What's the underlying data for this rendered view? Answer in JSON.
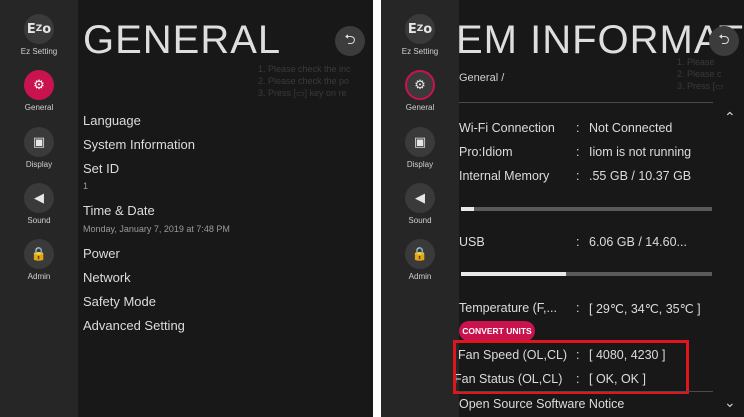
{
  "sidebar": {
    "items": [
      {
        "icon": "Ez",
        "label": "Ez Setting"
      },
      {
        "icon": "gear",
        "label": "General"
      },
      {
        "icon": "monitor",
        "label": "Display"
      },
      {
        "icon": "speaker",
        "label": "Sound"
      },
      {
        "icon": "lock",
        "label": "Admin"
      }
    ],
    "active": "General"
  },
  "left": {
    "title": "GENERAL",
    "ghost_lines": [
      "1. Please check the inc",
      "2. Please check the po",
      "3. Press [",
      "] key on re"
    ],
    "menu": [
      {
        "label": "Language"
      },
      {
        "label": "System Information"
      },
      {
        "label": "Set ID",
        "sub": "1"
      },
      {
        "label": "Time & Date",
        "sub": "Monday, January 7, 2019 at 7:48 PM"
      },
      {
        "label": "Power"
      },
      {
        "label": "Network"
      },
      {
        "label": "Safety Mode"
      },
      {
        "label": "Advanced Setting"
      }
    ]
  },
  "right": {
    "title": "EM INFORMATIC",
    "breadcrumb": "General /",
    "ghost_lines": [
      "1. Please",
      "2. Please c",
      "3. Press ["
    ],
    "rows": [
      {
        "label": "Wi-Fi Connection",
        "value": "Not Connected"
      },
      {
        "label": "Pro:Idiom",
        "value": "Iiom is not running"
      },
      {
        "label": "Internal Memory",
        "value": ".55 GB  /  10.37 GB"
      },
      {
        "label": "USB",
        "value": "6.06 GB  /  14.60..."
      },
      {
        "label": "Temperature (F,...",
        "value": "[ 29℃, 34℃, 35℃ ]"
      },
      {
        "label": "Fan Speed (OL,CL)",
        "value": "[ 4080, 4230 ]"
      },
      {
        "label": "Fan Status (OL,CL)",
        "value": "[ OK, OK ]"
      }
    ],
    "separator": ":",
    "internal_memory_fill": 0.05,
    "usb_fill": 0.42,
    "convert_units_label": "CONVERT UNITS",
    "open_source_notice": "Open Source Software Notice"
  },
  "colors": {
    "accent": "#c9134f",
    "highlight": "#e0161e",
    "panel_bg": "#181818",
    "sidebar_bg": "#262626"
  }
}
